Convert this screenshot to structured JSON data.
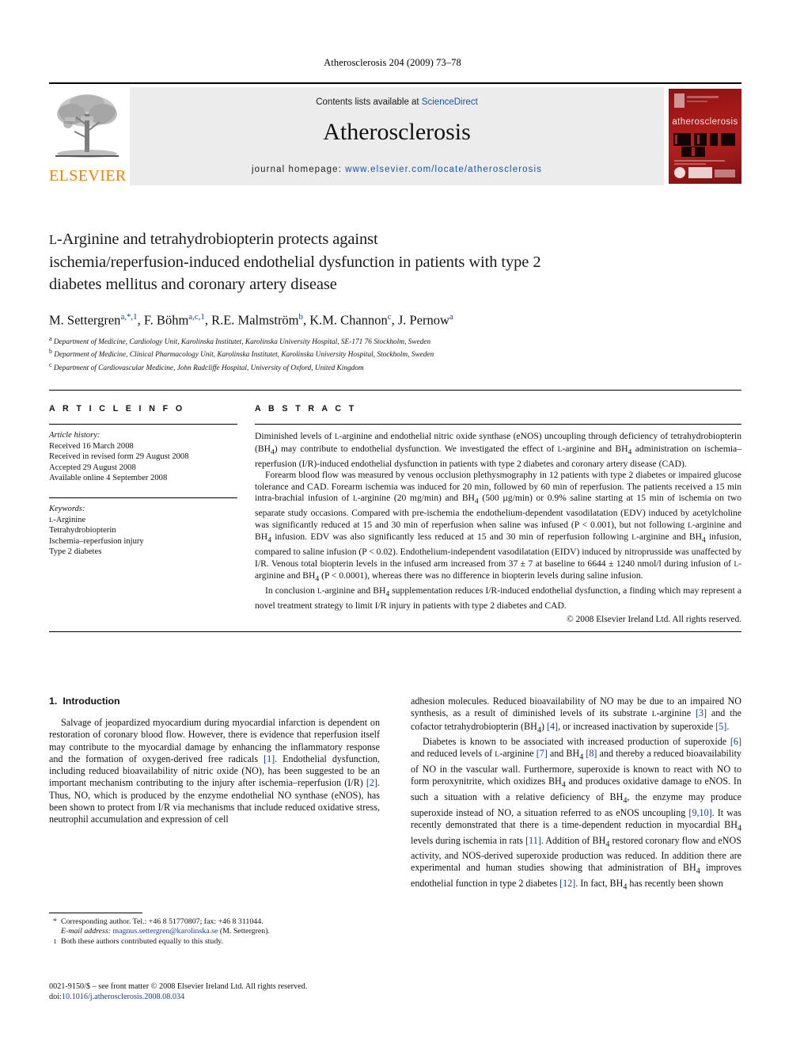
{
  "running_head": "Atherosclerosis 204 (2009) 73–78",
  "masthead": {
    "contents_prefix": "Contents lists available at ",
    "sciencedirect": "ScienceDirect",
    "journal_name": "Atherosclerosis",
    "homepage_label": "journal homepage:",
    "homepage_url": "www.elsevier.com/locate/atherosclerosis",
    "publisher": "ELSEVIER",
    "cover_title": "atherosclerosis"
  },
  "article": {
    "title_line1_small": "L",
    "title_line1": "-Arginine and tetrahydrobiopterin protects against",
    "title_line2": "ischemia/reperfusion-induced endothelial dysfunction in patients with type 2",
    "title_line3": "diabetes mellitus and coronary artery disease",
    "authors_html": "M. Settergren<sup>a,*,1</sup>, F. Böhm<sup>a,c,1</sup>, R.E. Malmström<sup>b</sup>, K.M. Channon<sup>c</sup>, J. Pernow<sup>a</sup>",
    "affiliations": [
      {
        "mark": "a",
        "text": "Department of Medicine, Cardiology Unit, Karolinska Institutet, Karolinska University Hospital, SE-171 76 Stockholm, Sweden"
      },
      {
        "mark": "b",
        "text": "Department of Medicine, Clinical Pharmacology Unit, Karolinska Institutet, Karolinska University Hospital, Stockholm, Sweden"
      },
      {
        "mark": "c",
        "text": "Department of Cardiovascular Medicine, John Radcliffe Hospital, University of Oxford, United Kingdom"
      }
    ]
  },
  "article_info": {
    "heading": "A R T I C L E   I N F O",
    "history_label": "Article history:",
    "history": [
      "Received 16 March 2008",
      "Received in revised form 29 August 2008",
      "Accepted 29 August 2008",
      "Available online 4 September 2008"
    ],
    "keywords_label": "Keywords:",
    "keywords": [
      "L-Arginine",
      "Tetrahydrobiopterin",
      "Ischemia–reperfusion injury",
      "Type 2 diabetes"
    ]
  },
  "abstract": {
    "heading": "A B S T R A C T",
    "paragraphs": [
      "Diminished levels of L-arginine and endothelial nitric oxide synthase (eNOS) uncoupling through deficiency of tetrahydrobiopterin (BH4) may contribute to endothelial dysfunction. We investigated the effect of L-arginine and BH4 administration on ischemia–reperfusion (I/R)-induced endothelial dysfunction in patients with type 2 diabetes and coronary artery disease (CAD).",
      "Forearm blood flow was measured by venous occlusion plethysmography in 12 patients with type 2 diabetes or impaired glucose tolerance and CAD. Forearm ischemia was induced for 20 min, followed by 60 min of reperfusion. The patients received a 15 min intra-brachial infusion of L-arginine (20 mg/min) and BH4 (500 µg/min) or 0.9% saline starting at 15 min of ischemia on two separate study occasions. Compared with pre-ischemia the endothelium-dependent vasodilatation (EDV) induced by acetylcholine was significantly reduced at 15 and 30 min of reperfusion when saline was infused (P < 0.001), but not following L-arginine and BH4 infusion. EDV was also significantly less reduced at 15 and 30 min of reperfusion following L-arginine and BH4 infusion, compared to saline infusion (P < 0.02). Endothelium-independent vasodilatation (EIDV) induced by nitroprusside was unaffected by I/R. Venous total biopterin levels in the infused arm increased from 37 ± 7 at baseline to 6644 ± 1240 nmol/l during infusion of L-arginine and BH4 (P < 0.0001), whereas there was no difference in biopterin levels during saline infusion.",
      "In conclusion L-arginine and BH4 supplementation reduces I/R-induced endothelial dysfunction, a finding which may represent a novel treatment strategy to limit I/R injury in patients with type 2 diabetes and CAD."
    ],
    "copyright": "© 2008 Elsevier Ireland Ltd. All rights reserved."
  },
  "introduction": {
    "number": "1.",
    "heading": "Introduction",
    "left_paragraph": "Salvage of jeopardized myocardium during myocardial infarction is dependent on restoration of coronary blood flow. However, there is evidence that reperfusion itself may contribute to the myocardial damage by enhancing the inflammatory response and the formation of oxygen-derived free radicals [1]. Endothelial dysfunction, including reduced bioavailability of nitric oxide (NO), has been suggested to be an important mechanism contributing to the injury after ischemia–reperfusion (I/R) [2]. Thus, NO, which is produced by the enzyme endothelial NO synthase (eNOS), has been shown to protect from I/R via mechanisms that include reduced oxidative stress, neutrophil accumulation and expression of cell",
    "right_paragraph_1": "adhesion molecules. Reduced bioavailability of NO may be due to an impaired NO synthesis, as a result of diminished levels of its substrate L-arginine [3] and the cofactor tetrahydrobiopterin (BH4) [4], or increased inactivation by superoxide [5].",
    "right_paragraph_2": "Diabetes is known to be associated with increased production of superoxide [6] and reduced levels of L-arginine [7] and BH4 [8] and thereby a reduced bioavailability of NO in the vascular wall. Furthermore, superoxide is known to react with NO to form peroxynitrite, which oxidizes BH4 and produces oxidative damage to eNOS. In such a situation with a relative deficiency of BH4, the enzyme may produce superoxide instead of NO, a situation referred to as eNOS uncoupling [9,10]. It was recently demonstrated that there is a time-dependent reduction in myocardial BH4 levels during ischemia in rats [11]. Addition of BH4 restored coronary flow and eNOS activity, and NOS-derived superoxide production was reduced. In addition there are experimental and human studies showing that administration of BH4 improves endothelial function in type 2 diabetes [12]. In fact, BH4 has recently been shown"
  },
  "footnotes": {
    "corresponding_mark": "*",
    "corresponding": "Corresponding author. Tel.: +46 8 51770807; fax: +46 8 311044.",
    "email_label": "E-mail address:",
    "email": "magnus.settergren@karolinska.se",
    "email_suffix": " (M. Settergren).",
    "equal_mark": "1",
    "equal_contribution": "Both these authors contributed equally to this study."
  },
  "imprint": {
    "line1": "0021-9150/$ – see front matter © 2008 Elsevier Ireland Ltd. All rights reserved.",
    "doi_label": "doi:",
    "doi": "10.1016/j.atherosclerosis.2008.08.034"
  },
  "colors": {
    "link": "#1a3c8c",
    "sciencedirect": "#1753a8",
    "elsevier_orange": "#F08000",
    "cover_red": "#a31818",
    "band_gray": "#ececec"
  }
}
